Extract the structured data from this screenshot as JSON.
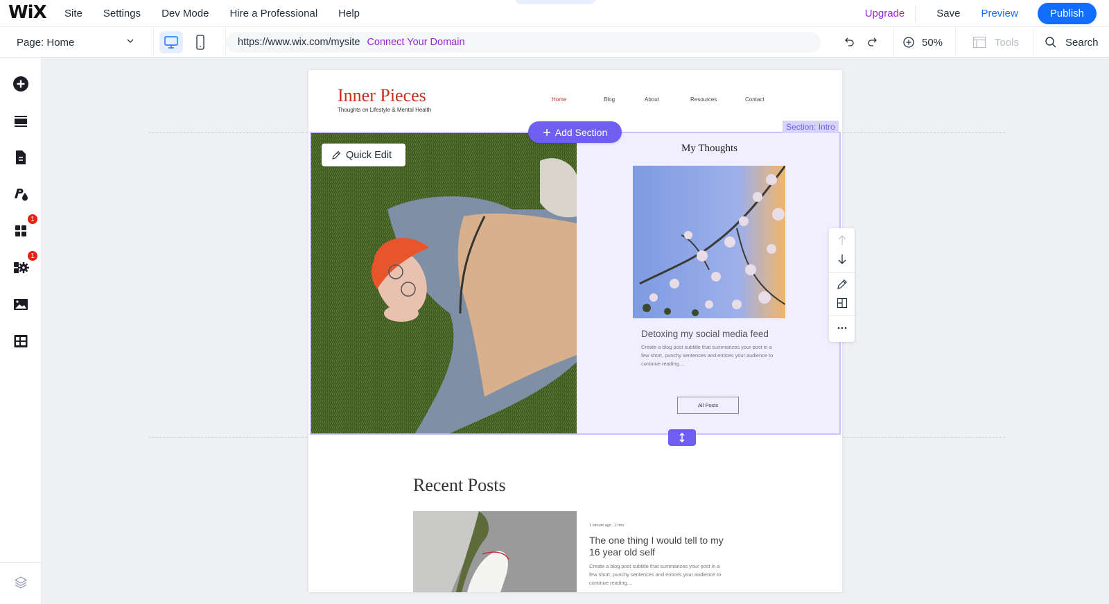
{
  "topbar": {
    "logo": "WiX",
    "menu": [
      "Site",
      "Settings",
      "Dev Mode",
      "Hire a Professional",
      "Help"
    ],
    "upgrade": "Upgrade",
    "save": "Save",
    "preview": "Preview",
    "publish": "Publish"
  },
  "toolbar": {
    "page_selector": "Page: Home",
    "url": "https://www.wix.com/mysite",
    "connect_domain": "Connect Your Domain",
    "zoom": "50%",
    "tools": "Tools",
    "search": "Search"
  },
  "sidebar": {
    "items": [
      {
        "name": "add-elements",
        "icon": "plus-circle-icon"
      },
      {
        "name": "add-section",
        "icon": "section-icon"
      },
      {
        "name": "pages-menu",
        "icon": "page-icon"
      },
      {
        "name": "site-design",
        "icon": "design-icon"
      },
      {
        "name": "add-apps",
        "icon": "apps-grid-icon",
        "badge": "1"
      },
      {
        "name": "business-apps",
        "icon": "apps-gear-icon",
        "badge": "1"
      },
      {
        "name": "media",
        "icon": "image-icon"
      },
      {
        "name": "cms",
        "icon": "table-icon"
      }
    ],
    "layers_icon": "layers-icon"
  },
  "site": {
    "title": "Inner Pieces",
    "tagline": "Thoughts on Lifestyle & Mental Health",
    "nav": [
      "Home",
      "Blog",
      "About",
      "Resources",
      "Contact"
    ],
    "nav_active": "Home",
    "accent": "#c7311c"
  },
  "editor": {
    "section_label": "Section: Intro",
    "add_section": "Add Section",
    "quick_edit": "Quick Edit",
    "accent": "#6e5ff0"
  },
  "intro": {
    "heading": "My Thoughts",
    "post_title": "Detoxing my social media feed",
    "post_subtitle": "Create a blog post subtitle that summarizes your post in a few short, punchy sentences and entices your audience to continue reading....",
    "all_posts": "All Posts"
  },
  "recent": {
    "heading": "Recent Posts",
    "meta": "1 minute ago  ·  2 min",
    "post_title": "The one thing I would tell to my 16 year old self",
    "post_subtitle": "Create a blog post subtitle that summarizes your post in a few short, punchy sentences and entices your audience to continue reading...."
  }
}
